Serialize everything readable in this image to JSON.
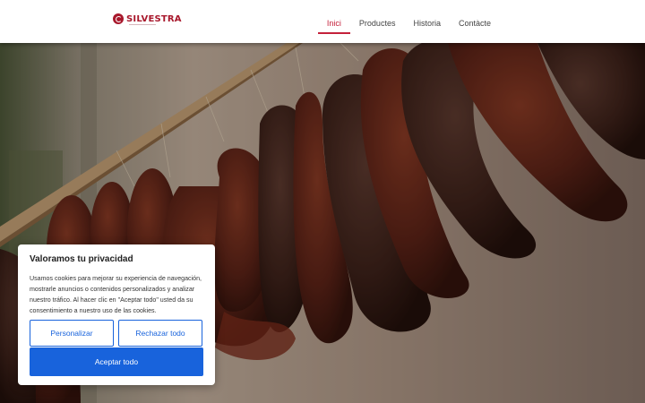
{
  "brand": {
    "name": "SILVESTRA"
  },
  "nav": {
    "items": [
      {
        "label": "Inici",
        "active": true
      },
      {
        "label": "Productes",
        "active": false
      },
      {
        "label": "Historia",
        "active": false
      },
      {
        "label": "Contàcte",
        "active": false
      }
    ]
  },
  "hero": {
    "image": "hanging-sausages-photo"
  },
  "cookie": {
    "title": "Valoramos tu privacidad",
    "text": "Usamos cookies para mejorar su experiencia de navegación, mostrarle anuncios o contenidos personalizados y analizar nuestro tráfico. Al hacer clic en \"Aceptar todo\" usted da su consentimiento a nuestro uso de las cookies.",
    "customize_label": "Personalizar",
    "reject_label": "Rechazar todo",
    "accept_label": "Aceptar todo"
  },
  "colors": {
    "brand": "#a8182c",
    "nav_active": "#c4213b",
    "button": "#1863dc"
  }
}
